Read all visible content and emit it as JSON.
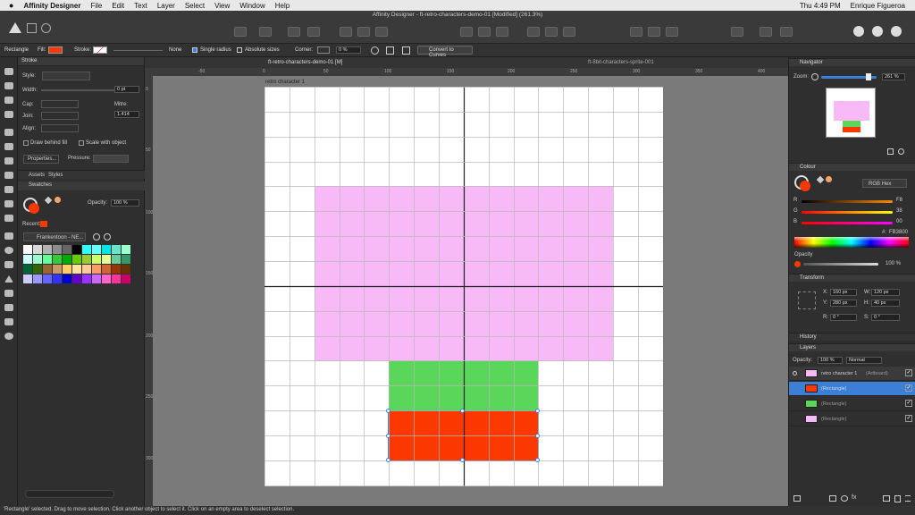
{
  "menubar": {
    "app_name": "Affinity Designer",
    "items": [
      "File",
      "Edit",
      "Text",
      "Layer",
      "Select",
      "View",
      "Window",
      "Help"
    ],
    "clock": "Thu 4:49 PM",
    "user": "Enrique Figueroa"
  },
  "toolbar": {
    "title": "Affinity Designer - ft-retro-characters-demo-01 [Modified] (261.3%)"
  },
  "context": {
    "shape": "Rectangle",
    "fill_label": "Fill:",
    "fill_color": "#fb3800",
    "stroke_label": "Stroke:",
    "stroke_value": "None",
    "single_radius": "Single radius",
    "absolute_sizes": "Absolute sizes",
    "corner_label": "Corner:",
    "corner_value": "0 %",
    "convert": "Convert to Curves"
  },
  "stroke_panel": {
    "tab": "Stroke",
    "style": "Style:",
    "width": "Width:",
    "width_value": "0 pt",
    "cap": "Cap:",
    "join": "Join:",
    "mitre": "Mitre:",
    "mitre_value": "1.414",
    "align": "Align:",
    "draw_behind": "Draw behind fill",
    "scale_with_object": "Scale with object",
    "properties": "Properties...",
    "pressure": "Pressure:"
  },
  "swatch_panel": {
    "tab_assets": "Assets",
    "tab_styles": "Styles",
    "tab_swatches": "Swatches",
    "opacity_label": "Opacity:",
    "opacity_value": "100 %",
    "recent": "Recent:",
    "palette_name": "Frankentoon - NE..."
  },
  "document": {
    "tab_active": "ft-retro-characters-demo-01 [M]",
    "tab_other": "ft-8bit-characters-sprite-001",
    "artboard_label": "retro character 1",
    "ruler_top": [
      "-50",
      "0",
      "50",
      "100",
      "150",
      "200",
      "250",
      "300",
      "350",
      "400"
    ],
    "ruler_left": [
      "0",
      "50",
      "100",
      "150",
      "200",
      "250",
      "300",
      "350"
    ]
  },
  "navigator": {
    "tab": "Navigator",
    "zoom_label": "Zoom:",
    "zoom_value": "261 %"
  },
  "colour_panel": {
    "tab": "Colour",
    "mode": "RGB Hex",
    "r_label": "R",
    "r_value": "F8",
    "g_label": "G",
    "g_value": "38",
    "b_label": "B",
    "b_value": "00",
    "hex_label": "#:",
    "hex_value": "FB3800",
    "opacity_label": "Opacity",
    "opacity_value": "100 %"
  },
  "transform_panel": {
    "tab": "Transform",
    "x_label": "X:",
    "x_value": "160 px",
    "y_label": "Y:",
    "y_value": "280 px",
    "w_label": "W:",
    "w_value": "120 px",
    "h_label": "H:",
    "h_value": "40 px",
    "r_label": "R:",
    "r_value": "0 °",
    "s_label": "S:",
    "s_value": "0 °"
  },
  "history_tab": "History",
  "layers_panel": {
    "tab": "Layers",
    "opacity_label": "Opacity:",
    "opacity_value": "100 %",
    "blend": "Normal",
    "rows": [
      {
        "name": "retro character 1",
        "sub": "(Artboard)",
        "color": "#f5bdf5"
      },
      {
        "name": "(Rectangle)",
        "sub": "",
        "color": "#fb3800"
      },
      {
        "name": "(Rectangle)",
        "sub": "",
        "color": "#5ad65a"
      },
      {
        "name": "(Rectangle)",
        "sub": "",
        "color": "#f5bdf5"
      }
    ]
  },
  "statusbar": {
    "text": "'Rectangle' selected. Drag to move selection. Click another object to select it. Click on an empty area to deselect selection."
  },
  "colors": {
    "pink": "#f7baf7",
    "green": "#5ad65a",
    "red": "#fb3800",
    "accent": "#3b7fd6"
  }
}
